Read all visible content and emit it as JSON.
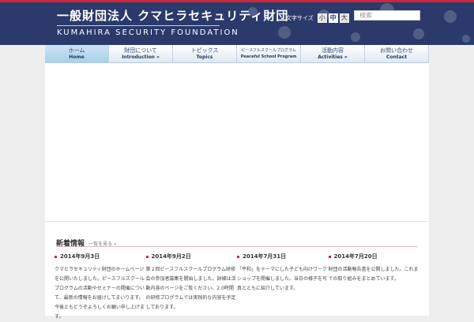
{
  "header": {
    "title_jp": "一般財団法人 クマヒラセキュリティ財団",
    "title_en": "KUMAHIRA SECURITY FOUNDATION"
  },
  "font_size": {
    "label": "文字サイズ",
    "small": "小",
    "medium": "中",
    "large": "大"
  },
  "search": {
    "placeholder": "検索"
  },
  "nav": [
    {
      "jp": "ホーム",
      "en": "Home"
    },
    {
      "jp": "財団について",
      "en": "Introduction »"
    },
    {
      "jp": "トピックス",
      "en": "Topics"
    },
    {
      "jp": "ピースフルスクールプログラム",
      "en": "Peaceful School Program"
    },
    {
      "jp": "活動内容",
      "en": "Activities »"
    },
    {
      "jp": "お問い合わせ",
      "en": "Contact"
    }
  ],
  "news": {
    "title": "新着情報",
    "link": "一覧を見る »",
    "items": [
      {
        "date": "2014年9月3日",
        "text": "クマヒラセキュリティ財団のホームページを公開いたしました。ピースフルスクールプログラムの活動やセミナーの開催について、最新の情報をお届けしてまいります。今後ともどうぞよろしくお願い申し上げます。"
      },
      {
        "date": "2014年9月2日",
        "text": "第２回ピースフルスクールプログラム研修会の参加者募集を開始しました。詳細は活動内容のページをご覧ください。2.0時間の研修プログラムでは実践的な内容を予定しております。"
      },
      {
        "date": "2014年7月31日",
        "text": "「平和」をテーマにした子ども向けワークショップを開催しました。当日の様子を写真とともに紹介しています。"
      },
      {
        "date": "2014年7月20日",
        "text": "財団の活動報告書を公開しました。これまでの取り組みをまとめています。"
      }
    ]
  }
}
